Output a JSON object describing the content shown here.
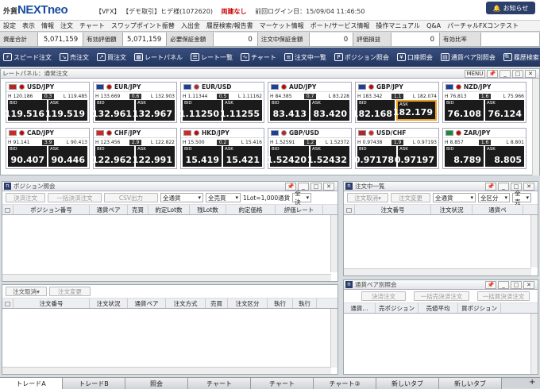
{
  "header": {
    "logo_small": "外貨",
    "logo_big": "NEXTneo",
    "vfx": "【VFX】",
    "demo": "【デモ取引】ヒデ様(1072620)",
    "status": "両建なし",
    "last_login": "前回ログイン日：15/09/04 11:46:50",
    "notice": "お知らせ"
  },
  "menu": [
    "設定",
    "表示",
    "情報",
    "注文",
    "チャート",
    "スワップポイント振替",
    "入出金",
    "履歴検索/報告書",
    "マーケット情報",
    "ポート/サービス情報",
    "操作マニュアル",
    "Q&A",
    "パーチャルFXコンテスト"
  ],
  "account": [
    {
      "label": "資産合計",
      "value": "5,071,159"
    },
    {
      "label": "有効評価額",
      "value": "5,071,159"
    },
    {
      "label": "必要保証金額",
      "value": "0"
    },
    {
      "label": "注文中保証金額",
      "value": "0"
    },
    {
      "label": "評価損益",
      "value": "0"
    },
    {
      "label": "有効比率",
      "value": ""
    }
  ],
  "toolbar": [
    "スピード注文",
    "売注文",
    "買注文",
    "レートパネル",
    "レート一覧",
    "チャート",
    "注文中一覧",
    "ポジション照会",
    "口座照会",
    "通貨ペア別照会",
    "履歴検索"
  ],
  "rate_panel": {
    "title": "レートパネル：通常注文",
    "menu": "MENU"
  },
  "rates": [
    {
      "pair": "USD/JPY",
      "flag1": "#b22",
      "flag2": "#c00",
      "high": "120.186",
      "spread": "0.3",
      "low": "119.485",
      "bid": "119.516",
      "ask": "119.519"
    },
    {
      "pair": "EUR/JPY",
      "flag1": "#1a3fa0",
      "flag2": "#c00",
      "high": "133.669",
      "spread": "0.6",
      "low": "132.903",
      "bid": "132.961",
      "ask": "132.967"
    },
    {
      "pair": "EUR/USD",
      "flag1": "#1a3fa0",
      "flag2": "#b22",
      "high": "1.11344",
      "spread": "0.5",
      "low": "1.11162",
      "bid": "1.11250",
      "ask": "1.11255"
    },
    {
      "pair": "AUD/JPY",
      "flag1": "#1a3fa0",
      "flag2": "#c00",
      "high": "84.385",
      "spread": "0.7",
      "low": "83.228",
      "bid": "83.413",
      "ask": "83.420"
    },
    {
      "pair": "GBP/JPY",
      "flag1": "#1a3fa0",
      "flag2": "#c00",
      "high": "183.342",
      "spread": "1.1",
      "low": "182.074",
      "bid": "182.168",
      "ask": "182.179"
    },
    {
      "pair": "NZD/JPY",
      "flag1": "#1a3fa0",
      "flag2": "#c00",
      "high": "76.813",
      "spread": "1.6",
      "low": "75.966",
      "bid": "76.108",
      "ask": "76.124"
    },
    {
      "pair": "CAD/JPY",
      "flag1": "#d22",
      "flag2": "#c00",
      "high": "91.141",
      "spread": "3.9",
      "low": "90.413",
      "bid": "90.407",
      "ask": "90.446"
    },
    {
      "pair": "CHF/JPY",
      "flag1": "#d22",
      "flag2": "#c00",
      "high": "123.456",
      "spread": "2.9",
      "low": "122.822",
      "bid": "122.962",
      "ask": "122.991"
    },
    {
      "pair": "HKD/JPY",
      "flag1": "#d22",
      "flag2": "#c00",
      "high": "15.500",
      "spread": "0.2",
      "low": "15.416",
      "bid": "15.419",
      "ask": "15.421"
    },
    {
      "pair": "GBP/USD",
      "flag1": "#1a3fa0",
      "flag2": "#b22",
      "high": "1.52591",
      "spread": "1.2",
      "low": "1.52372",
      "bid": "1.52420",
      "ask": "1.52432"
    },
    {
      "pair": "USD/CHF",
      "flag1": "#b22",
      "flag2": "#d22",
      "high": "0.97438",
      "spread": "1.9",
      "low": "0.97193",
      "bid": "0.97178",
      "ask": "0.97197"
    },
    {
      "pair": "ZAR/JPY",
      "flag1": "#1a8a3a",
      "flag2": "#c00",
      "high": "8.857",
      "spread": "1.6",
      "low": "8.801",
      "bid": "8.789",
      "ask": "8.805"
    }
  ],
  "labels": {
    "high": "H",
    "low": "L",
    "bid": "BID",
    "ask": "ASK"
  },
  "position_panel": {
    "title": "ポジション照会",
    "buttons": [
      "決済注文",
      "一括決済注文",
      "CSV出力"
    ],
    "filters": [
      "全通貨",
      "全売買"
    ],
    "lot": "1Lot=1,000通貨",
    "filter3": "全決",
    "columns": [
      "ポジション番号",
      "通貨ペア",
      "売買",
      "約定Lot数",
      "残Lot数",
      "約定価格",
      "評価レート"
    ]
  },
  "order_panel2": {
    "buttons": [
      "注文取消",
      "注文変更"
    ],
    "columns": [
      "注文番号",
      "注文状況",
      "通貨ペア",
      "注文方式",
      "売買",
      "注文区分",
      "執行",
      "執行"
    ]
  },
  "order_list": {
    "title": "注文中一覧",
    "buttons": [
      "注文取消",
      "注文変更"
    ],
    "filters": [
      "全通貨",
      "全区分",
      "全売"
    ],
    "columns": [
      "注文番号",
      "注文状況",
      "通貨ペ"
    ]
  },
  "pair_panel": {
    "title": "通貨ペア別照会",
    "buttons": [
      "決済注文",
      "一括売決済注文",
      "一括買決済注文"
    ],
    "columns": [
      "通貨...",
      "売ポジション",
      "売値平均",
      "買ポジション"
    ]
  },
  "tabs": [
    "トレードA",
    "トレードB",
    "照会",
    "チャート",
    "チャート",
    "チャート③",
    "新しいタブ",
    "新しいタブ"
  ]
}
